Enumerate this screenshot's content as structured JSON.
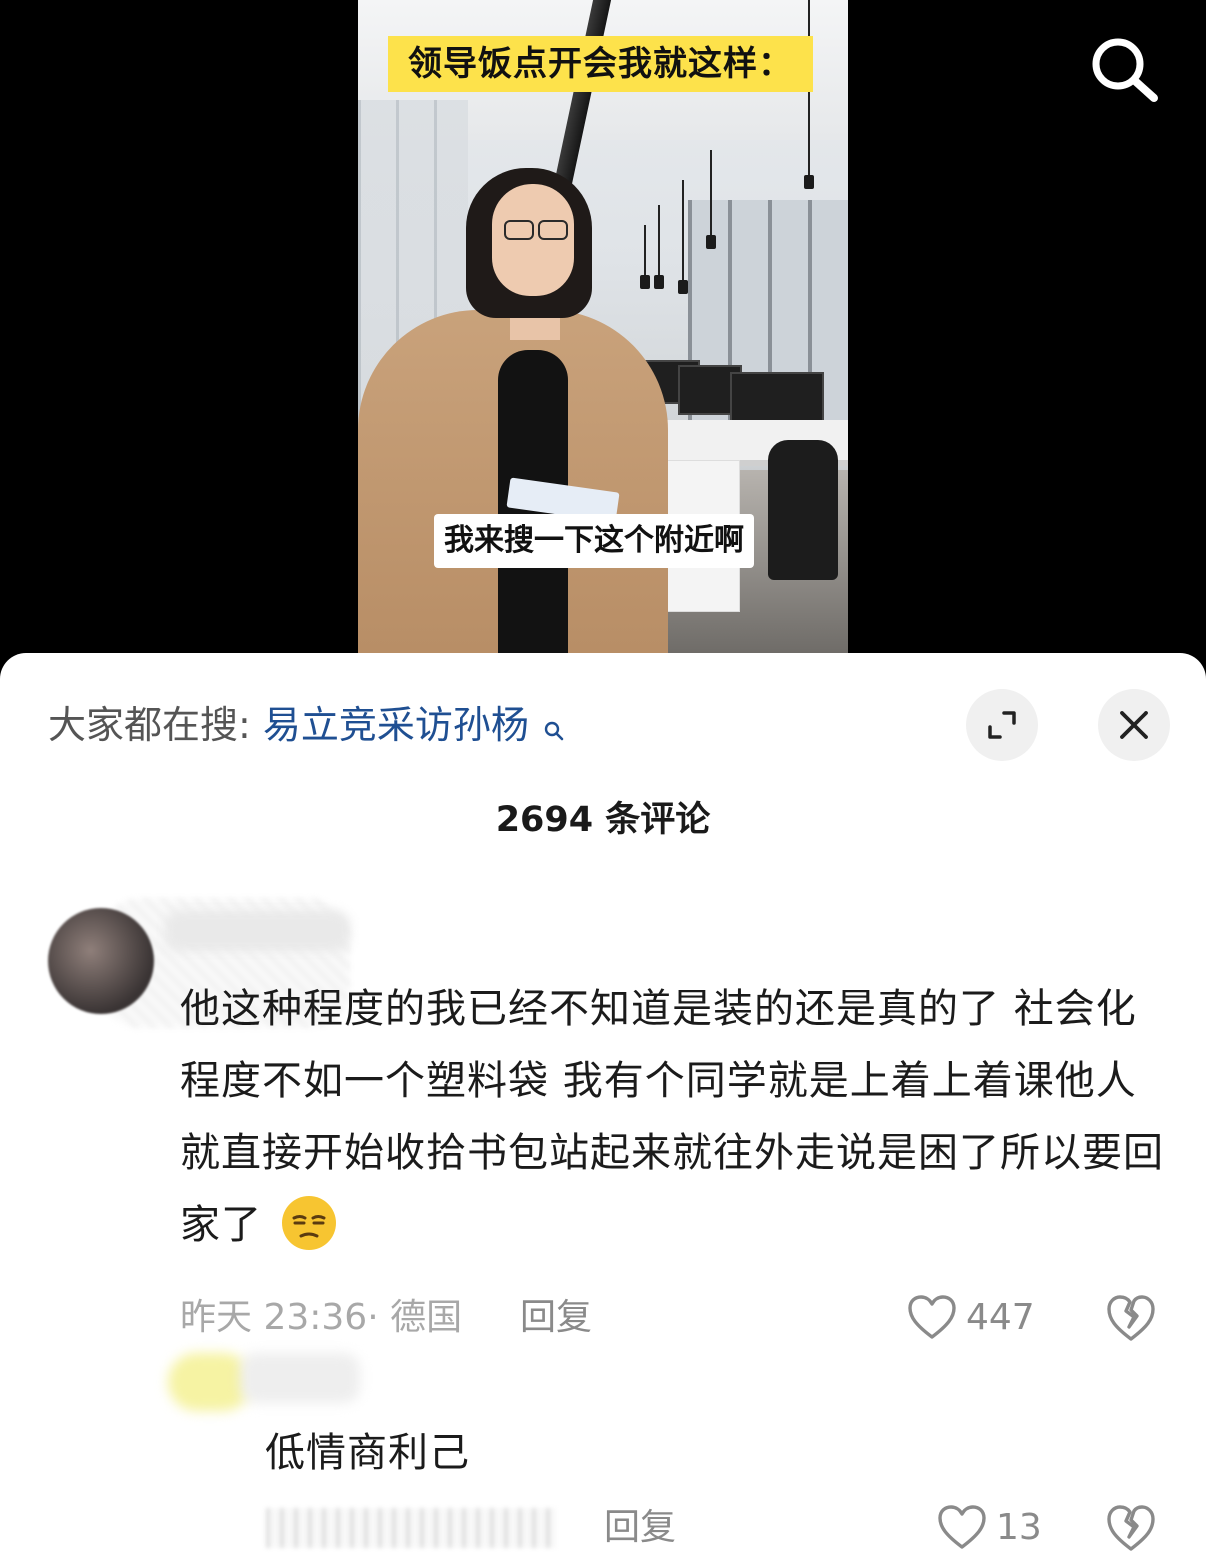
{
  "video": {
    "title_caption": "领导饭点开会我就这样：",
    "subtitle_caption": "我来搜一下这个附近啊",
    "search_icon": "search-icon"
  },
  "comments_panel": {
    "trending_label": "大家都在搜:",
    "trending_query": "易立竞采访孙杨",
    "expand_icon": "expand-icon",
    "close_icon": "close-icon",
    "comment_count_title": "2694 条评论"
  },
  "comments": [
    {
      "text": "他这种程度的我已经不知道是装的还是真的了 社会化程度不如一个塑料袋 我有个同学就是上着上着课他人就直接开始收拾书包站起来就往外走说是困了所以要回家了",
      "emoji": "unamused-face-emoji",
      "meta": "昨天 23:36· 德国",
      "reply_label": "回复",
      "likes": "447"
    }
  ],
  "replies": [
    {
      "text": "低情商利己",
      "reply_label": "回复",
      "likes": "13"
    }
  ],
  "colors": {
    "caption_yellow": "#fde24b",
    "link_blue": "#1f4f92",
    "meta_gray": "#a8a8a8"
  }
}
